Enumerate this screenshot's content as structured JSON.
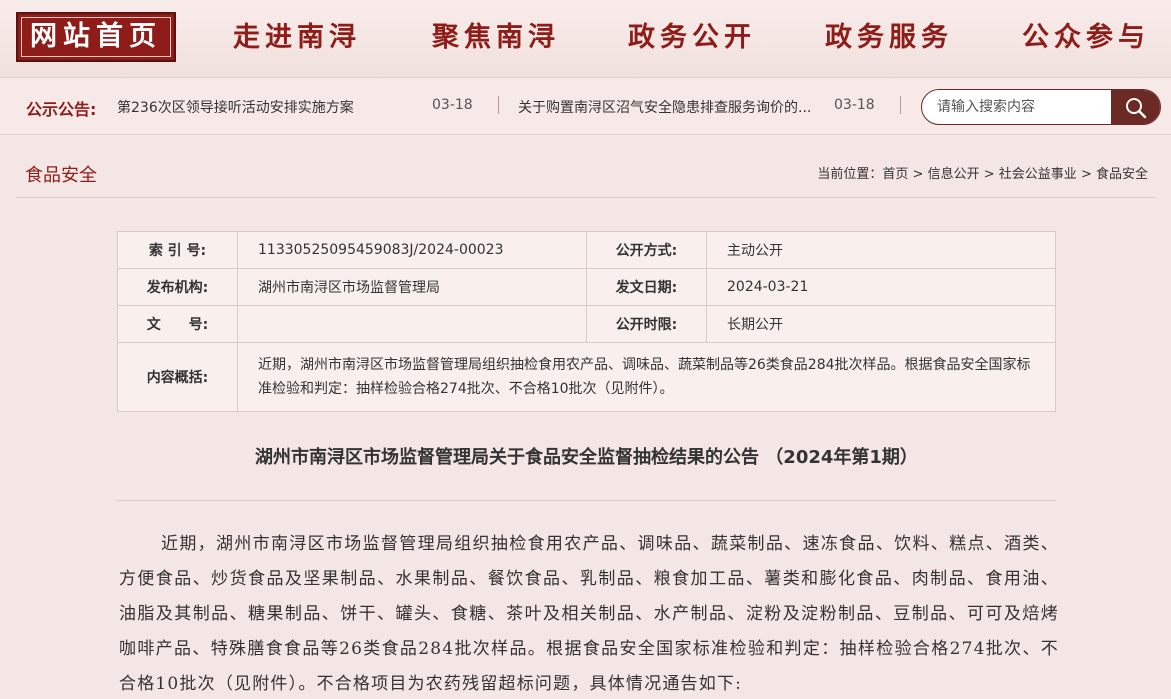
{
  "nav": {
    "home": "网站首页",
    "items": [
      "走进南浔",
      "聚焦南浔",
      "政务公开",
      "政务服务",
      "公众参与"
    ]
  },
  "notice": {
    "label": "公示公告:",
    "items": [
      {
        "text": "第236次区领导接听活动安排实施方案",
        "date": "03-18"
      },
      {
        "text": "关于购置南浔区沼气安全隐患排查服务询价的...",
        "date": "03-18"
      }
    ]
  },
  "search": {
    "placeholder": "请输入搜索内容",
    "icon": "search-icon"
  },
  "page": {
    "section_title": "食品安全",
    "breadcrumb": {
      "prefix": "当前位置：",
      "items": [
        "首页",
        "信息公开",
        "社会公益事业",
        "食品安全"
      ],
      "separator": ">"
    }
  },
  "meta": {
    "index_label": "索 引 号:",
    "index_value": "11330525095459083J/2024-00023",
    "method_label": "公开方式:",
    "method_value": "主动公开",
    "issuer_label": "发布机构:",
    "issuer_value": "湖州市南浔区市场监督管理局",
    "date_label": "发文日期:",
    "date_value": "2024-03-21",
    "docno_label": "文　　号:",
    "docno_value": "",
    "period_label": "公开时限:",
    "period_value": "长期公开",
    "summary_label": "内容概括:",
    "summary_value": "近期，湖州市南浔区市场监督管理局组织抽检食用农产品、调味品、蔬菜制品等26类食品284批次样品。根据食品安全国家标准检验和判定：抽样检验合格274批次、不合格10批次（见附件）。"
  },
  "article": {
    "title": "湖州市南浔区市场监督管理局关于食品安全监督抽检结果的公告 （2024年第1期）",
    "body": "近期，湖州市南浔区市场监督管理局组织抽检食用农产品、调味品、蔬菜制品、速冻食品、饮料、糕点、酒类、方便食品、炒货食品及坚果制品、水果制品、餐饮食品、乳制品、粮食加工品、薯类和膨化食品、肉制品、食用油、油脂及其制品、糖果制品、饼干、罐头、食糖、茶叶及相关制品、水产制品、淀粉及淀粉制品、豆制品、可可及焙烤咖啡产品、特殊膳食食品等26类食品284批次样品。根据食品安全国家标准检验和判定：抽样检验合格274批次、不合格10批次（见附件）。不合格项目为农药残留超标问题，具体情况通告如下:"
  },
  "colors": {
    "brand": "#8e1d19",
    "page_bg": "#f4e6e4",
    "search_button": "#6b2a26"
  }
}
